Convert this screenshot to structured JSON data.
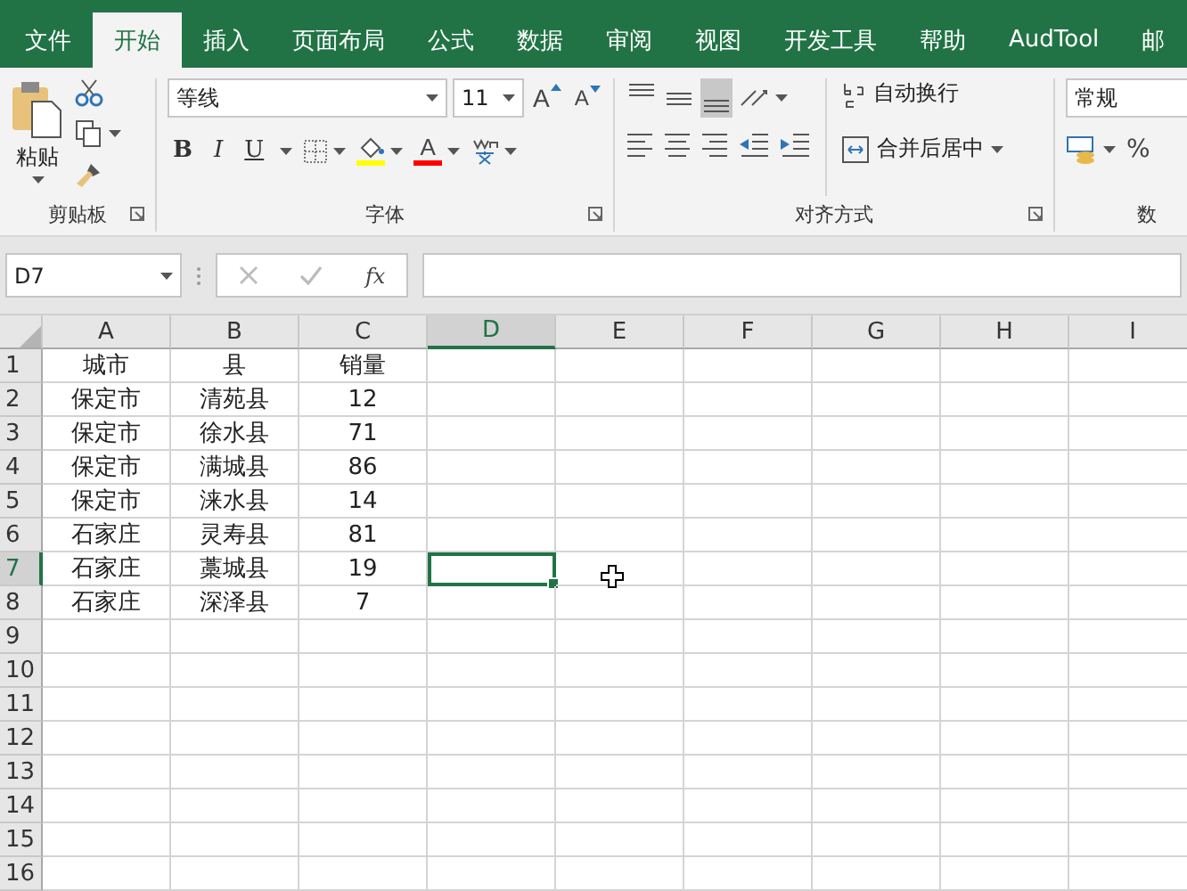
{
  "tabs": [
    {
      "label": "文件",
      "selected": false
    },
    {
      "label": "开始",
      "selected": true
    },
    {
      "label": "插入",
      "selected": false
    },
    {
      "label": "页面布局",
      "selected": false
    },
    {
      "label": "公式",
      "selected": false
    },
    {
      "label": "数据",
      "selected": false
    },
    {
      "label": "审阅",
      "selected": false
    },
    {
      "label": "视图",
      "selected": false
    },
    {
      "label": "开发工具",
      "selected": false
    },
    {
      "label": "帮助",
      "selected": false
    },
    {
      "label": "AudTool",
      "selected": false
    },
    {
      "label": "邮",
      "selected": false
    }
  ],
  "ribbon": {
    "clipboard": {
      "paste_label": "粘贴",
      "group_label": "剪贴板"
    },
    "font": {
      "font_name": "等线",
      "font_size": "11",
      "grow_label": "A",
      "shrink_label": "A",
      "style_buttons": [
        "B",
        "I",
        "U"
      ],
      "color_label": "A",
      "group_label": "字体"
    },
    "alignment": {
      "vertical_align_buttons": [
        {
          "selected": false
        },
        {
          "selected": false
        },
        {
          "selected": true
        }
      ],
      "wrap_label": "自动换行",
      "merge_label": "合并后居中",
      "group_label": "对齐方式"
    },
    "number": {
      "format": "常规",
      "percent_label": "%",
      "group_label": "数"
    }
  },
  "formula_bar": {
    "name_box": "D7",
    "fx_label": "fx"
  },
  "sheet": {
    "columns": [
      {
        "label": "A",
        "selected": false
      },
      {
        "label": "B",
        "selected": false
      },
      {
        "label": "C",
        "selected": false
      },
      {
        "label": "D",
        "selected": true
      },
      {
        "label": "E",
        "selected": false
      },
      {
        "label": "F",
        "selected": false
      },
      {
        "label": "G",
        "selected": false
      },
      {
        "label": "H",
        "selected": false
      },
      {
        "label": "I",
        "selected": false
      }
    ],
    "rows": [
      {
        "label": "1",
        "selected": false,
        "cells": [
          "城市",
          "县",
          "销量"
        ]
      },
      {
        "label": "2",
        "selected": false,
        "cells": [
          "保定市",
          "清苑县",
          "12"
        ]
      },
      {
        "label": "3",
        "selected": false,
        "cells": [
          "保定市",
          "徐水县",
          "71"
        ]
      },
      {
        "label": "4",
        "selected": false,
        "cells": [
          "保定市",
          "满城县",
          "86"
        ]
      },
      {
        "label": "5",
        "selected": false,
        "cells": [
          "保定市",
          "涞水县",
          "14"
        ]
      },
      {
        "label": "6",
        "selected": false,
        "cells": [
          "石家庄",
          "灵寿县",
          "81"
        ]
      },
      {
        "label": "7",
        "selected": true,
        "cells": [
          "石家庄",
          "藁城县",
          "19"
        ]
      },
      {
        "label": "8",
        "selected": false,
        "cells": [
          "石家庄",
          "深泽县",
          "7"
        ]
      },
      {
        "label": "9",
        "selected": false
      },
      {
        "label": "10",
        "selected": false
      },
      {
        "label": "11",
        "selected": false
      },
      {
        "label": "12",
        "selected": false
      },
      {
        "label": "13",
        "selected": false
      },
      {
        "label": "14",
        "selected": false
      },
      {
        "label": "15",
        "selected": false
      },
      {
        "label": "16",
        "selected": false
      }
    ]
  }
}
